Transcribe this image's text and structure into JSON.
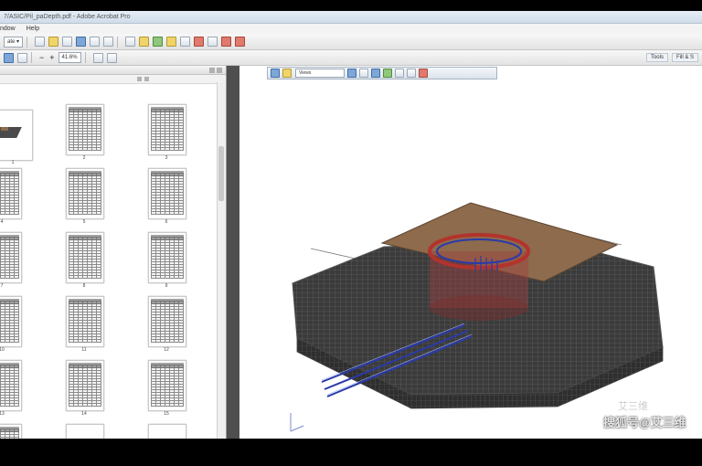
{
  "window": {
    "title": "7/ASIC/Pil_paDepth.pdf - Adobe Acrobat Pro"
  },
  "menu": {
    "items": [
      "ndow",
      "Help"
    ]
  },
  "toolbar": {
    "create_label": "ate ▾",
    "zoom_value": "41.6%",
    "page_nav_minus": "−",
    "page_nav_plus": "+",
    "right_tools": [
      "Tools",
      "Fill & S"
    ]
  },
  "toolbar3d": {
    "view_select": "Views"
  },
  "thumbnails": {
    "page_numbers": [
      "1",
      "2",
      "3",
      "4",
      "5",
      "6",
      "7",
      "8",
      "9",
      "10",
      "11",
      "12",
      "13",
      "14",
      "15"
    ]
  },
  "watermark": {
    "line1": "艾三维",
    "line2": "搜狐号@艾三维"
  },
  "colors": {
    "accent": "#3a6ea5",
    "pile_cap": "#8d6b4c",
    "ground_mesh": "#4a4a4a",
    "ring": "#b3332c",
    "tunnel": "#2a3aa8"
  }
}
